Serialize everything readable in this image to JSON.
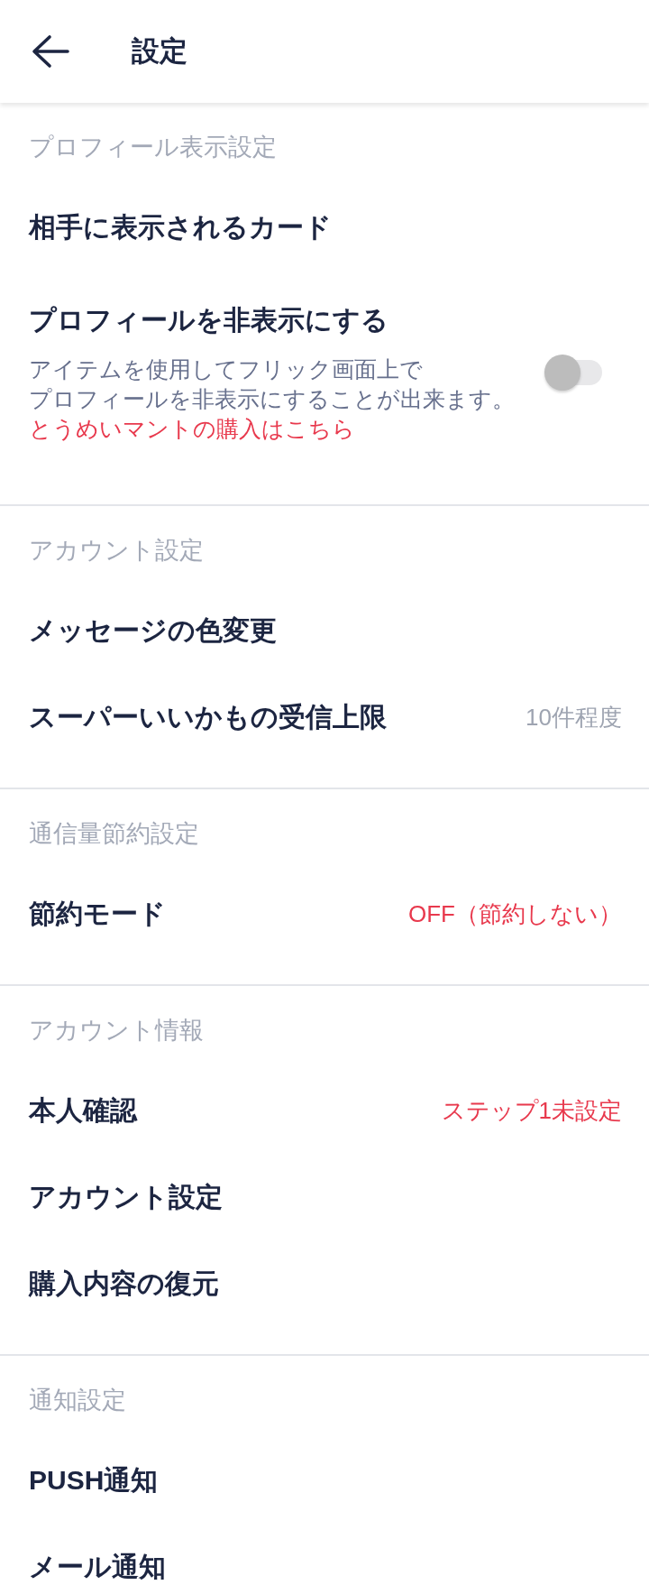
{
  "header": {
    "title": "設定"
  },
  "sections": [
    {
      "title": "プロフィール表示設定",
      "items": [
        {
          "kind": "link",
          "label": "相手に表示されるカード"
        },
        {
          "kind": "toggle",
          "label": "プロフィールを非表示にする",
          "description": [
            "アイテムを使用してフリック画面上で",
            "プロフィールを非表示にすることが出来ます。"
          ],
          "link": "とうめいマントの購入はこちら",
          "on": false
        }
      ]
    },
    {
      "title": "アカウント設定",
      "items": [
        {
          "kind": "link",
          "label": "メッセージの色変更"
        },
        {
          "kind": "value",
          "label": "スーパーいいかもの受信上限",
          "value": "10件程度",
          "alert": false
        }
      ]
    },
    {
      "title": "通信量節約設定",
      "items": [
        {
          "kind": "value",
          "label": "節約モード",
          "value": "OFF（節約しない）",
          "alert": true
        }
      ]
    },
    {
      "title": "アカウント情報",
      "items": [
        {
          "kind": "value",
          "label": "本人確認",
          "value": "ステップ1未設定",
          "alert": true
        },
        {
          "kind": "link",
          "label": "アカウント設定"
        },
        {
          "kind": "link",
          "label": "購入内容の復元"
        }
      ]
    },
    {
      "title": "通知設定",
      "items": [
        {
          "kind": "link",
          "label": "PUSH通知"
        },
        {
          "kind": "link",
          "label": "メール通知"
        }
      ]
    }
  ]
}
